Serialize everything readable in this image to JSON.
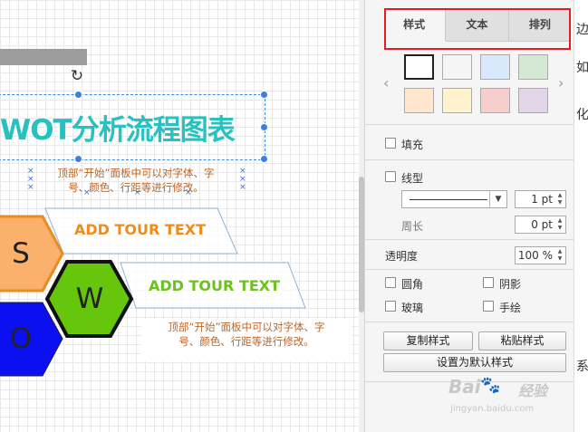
{
  "canvas": {
    "title": "WOT分析流程图表",
    "desc_top": [
      "顶部“开始”面板中可以对字体、字",
      "号、颜色、行距等进行修改。"
    ],
    "desc_bottom": [
      "顶部“开始”面板中可以对字体、字",
      "号、颜色、行距等进行修改。"
    ],
    "label_1": "ADD TOUR TEXT",
    "label_2": "ADD TOUR TEXT",
    "hex_s": "S",
    "hex_w": "W",
    "hex_o": "O",
    "rotate_icon": "↻",
    "colors": {
      "title": "#27c2c0",
      "label_1": "#f08c1c",
      "label_2": "#6cc21c",
      "hex_s": "#fbb06c",
      "hex_w": "#66c60c",
      "hex_o": "#0a10f0"
    }
  },
  "panel": {
    "tabs": [
      {
        "label": "样式",
        "active": true
      },
      {
        "label": "文本",
        "active": false
      },
      {
        "label": "排列",
        "active": false
      }
    ],
    "swatches": [
      "#ffffff",
      "#f5f5f5",
      "#dae8fc",
      "#d5e8d4",
      "#ffe6cc",
      "#fff2cc",
      "#f8cecc",
      "#e1d5e7"
    ],
    "fill_label": "填充",
    "line_label": "线型",
    "line_width": "1 pt",
    "perimeter_label": "周长",
    "perimeter_value": "0 pt",
    "opacity_label": "透明度",
    "opacity_value": "100 %",
    "rounded_label": "圆角",
    "shadow_label": "阴影",
    "glass_label": "玻璃",
    "sketch_label": "手绘",
    "copy_style": "复制样式",
    "paste_style": "粘贴样式",
    "set_default": "设置为默认样式"
  },
  "strip_chars": [
    "边",
    "如",
    "化",
    "系"
  ],
  "watermark": {
    "brand": "Bai",
    "brand_cn": "经验",
    "url": "jingyan.baidu.com"
  }
}
